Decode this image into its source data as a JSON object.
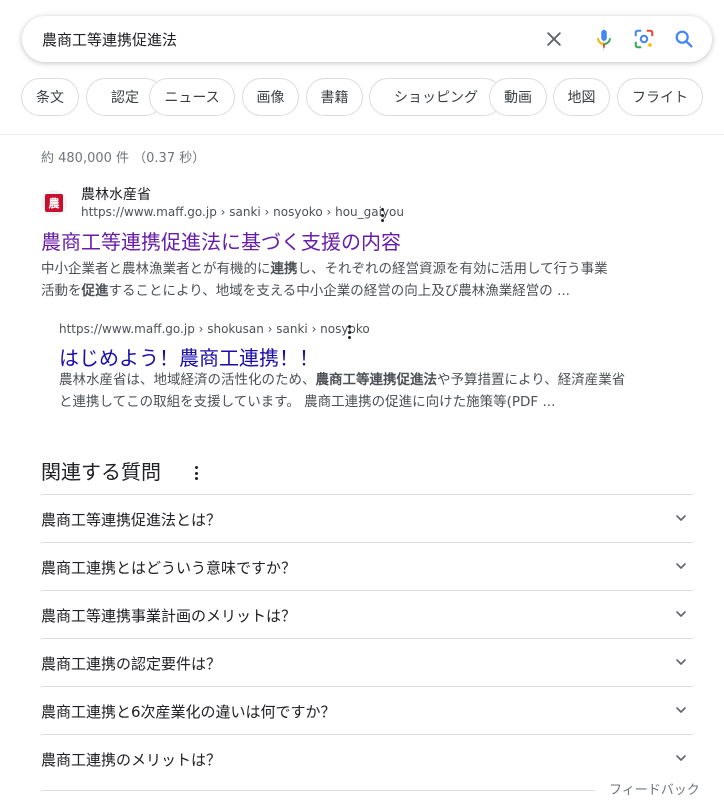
{
  "search": {
    "query": "農商工等連携促進法"
  },
  "icons": {
    "clear": "close-icon",
    "voice": "microphone-icon",
    "lens": "lens-icon",
    "search": "search-icon"
  },
  "chips": [
    "条文",
    "認定",
    "ニュース",
    "画像",
    "書籍",
    "ショッピング",
    "動画",
    "地図",
    "フライト"
  ],
  "stats": "約 480,000 件 （0.37 秒）",
  "result": {
    "site_name": "農林水産省",
    "favicon_text": "農",
    "url": "https://www.maff.go.jp › sanki › nosyoko › hou_gaiyou",
    "title": "農商工等連携促進法に基づく支援の内容",
    "snippet_line1_parts": [
      "中小企業者と農林漁業者とが有機的に",
      "連携",
      "し、それぞれの経営資源を有効に活用して行う事業"
    ],
    "snippet_line2_parts": [
      "活動を",
      "促進",
      "することにより、地域を支える中小企業の経営の向上及び農林漁業経営の ..."
    ]
  },
  "sub_result": {
    "url": "https://www.maff.go.jp › shokusan › sanki › nosyoko",
    "title": "はじめよう！農商工連携！！",
    "snippet_line1_parts": [
      "農林水産省は、地域経済の活性化のため、",
      "農商工等連携促進法",
      "や予算措置により、経済産業省"
    ],
    "snippet_line2": "と連携してこの取組を支援しています。 農商工連携の促進に向けた施策等(PDF ..."
  },
  "paa": {
    "heading": "関連する質問",
    "questions": [
      "農商工等連携促進法とは？",
      "農商工連携とはどういう意味ですか？",
      "農商工等連携事業計画のメリットは？",
      "農商工連携の認定要件は？",
      "農商工連携と6次産業化の違いは何ですか？",
      "農商工連携のメリットは？"
    ]
  },
  "feedback": "フィードバック",
  "colors": {
    "visited_link": "#681da8",
    "link": "#1a0dab",
    "mic_blue": "#4285f4",
    "mic_red": "#ea4335"
  }
}
